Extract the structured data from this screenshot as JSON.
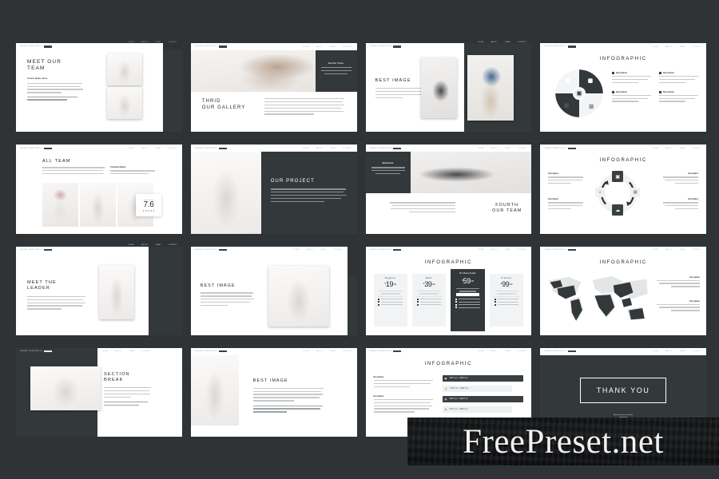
{
  "background_color": "#2f3336",
  "watermark": {
    "text": "FreePreset.net"
  },
  "slide_chrome": {
    "logo_text": "MINIMAL PRESENTATION",
    "nav": [
      "HOME",
      "ABOUT",
      "TEAM",
      "CONTACT"
    ]
  },
  "slides": [
    {
      "id": "meet-our-team",
      "title": "MEET OUR\nTEAM",
      "title_line1": "MEET OUR",
      "title_line2": "TEAM",
      "subhead": "Create Name Here",
      "body": "Lorem ipsum dolor sit amet consectetur adipiscing elit sed do eiusmod tempor incididunt ut labore et dolore magna aliqua ut enim ad minim veniam quis nostrud exercitation.",
      "body2": "Nisi ut aliquip ex ea commodo consequat duis aute irure dolor."
    },
    {
      "id": "thrid-our-gallery",
      "title_line1": "THRID",
      "title_line2": "OUR GALLERY",
      "panel_head": "Section Three",
      "panel_body": "Lorem ipsum dolor sit amet consectetur adipiscing elit sed do eiusmod tempor incididunt.",
      "body": "Excepteur sint occaecat cupidatat non proident sunt in culpa qui officia deserunt mollit anim id est laborum sed ut perspiciatis unde omnis iste natus error sit voluptatem accusantium doloremque laudantium totam rem aperiam."
    },
    {
      "id": "best-image-1",
      "title": "BEST IMAGE",
      "body": "Lorem ipsum dolor sit amet consectetur adipiscing elit sed do eiusmod tempor incididunt ut labore et dolore magna aliqua."
    },
    {
      "id": "infographic-circle",
      "title": "INFOGRAPHIC",
      "items": [
        {
          "icon": "briefcase-icon",
          "label": "Description",
          "body": "Lorem ipsum dolor sit amet consectetur adipiscing elit sed do eiusmod."
        },
        {
          "icon": "monitor-icon",
          "label": "Description",
          "body": "Lorem ipsum dolor sit amet consectetur adipiscing elit sed do eiusmod."
        },
        {
          "icon": "cloud-icon",
          "label": "Description",
          "body": "Lorem ipsum dolor sit amet consectetur adipiscing elit sed do eiusmod."
        },
        {
          "icon": "chart-icon",
          "label": "Description",
          "body": "Lorem ipsum dolor sit amet consectetur adipiscing elit sed do eiusmod."
        }
      ]
    },
    {
      "id": "all-team",
      "title": "ALL TEAM",
      "body": "Lorem ipsum dolor sit amet consectetur adipiscing elit sed do eiusmod tempor incididunt ut labore et dolore magna aliqua ut enim ad minim veniam quis nostrud.",
      "side_head": "Total Description",
      "side_body": "Lorem ipsum dolor sit amet consectetur adipiscing.",
      "rating_label": "user rating",
      "rating_value": "7.6",
      "rating_stars": 5
    },
    {
      "id": "our-project",
      "title": "OUR PROJECT",
      "body": "Lorem ipsum dolor sit amet consectetur adipiscing elit sed do eiusmod tempor incididunt ut labore et dolore magna aliqua ut enim ad minim veniam quis nostrud exercitation ullamco laboris nisi ut aliquip."
    },
    {
      "id": "fourth-our-team",
      "title_line1": "FOURTH",
      "title_line2": "OUR TEAM",
      "panel_head": "Section Four",
      "panel_body": "Lorem ipsum dolor sit amet consectetur adipiscing elit sed do eiusmod tempor incididunt ut labore.",
      "body": "Excepteur sint occaecat cupidatat non proident sunt in culpa qui officia deserunt mollit anim id est laborum sed ut perspiciatis unde omnis."
    },
    {
      "id": "infographic-cycle",
      "title": "INFOGRAPHIC",
      "items": [
        {
          "label": "Description",
          "body": "Lorem ipsum dolor sit amet consectetur adipiscing elit."
        },
        {
          "label": "Description",
          "body": "Lorem ipsum dolor sit amet consectetur adipiscing elit."
        },
        {
          "label": "Description",
          "body": "Lorem ipsum dolor sit amet consectetur adipiscing elit."
        },
        {
          "label": "Description",
          "body": "Lorem ipsum dolor sit amet consectetur adipiscing elit."
        }
      ],
      "icons": [
        "briefcase-icon",
        "monitor-icon",
        "cloud-icon",
        "search-icon"
      ]
    },
    {
      "id": "meet-the-leader",
      "title_line1": "MEET THE",
      "title_line2": "LEADER",
      "body": "Lorem ipsum dolor sit amet consectetur adipiscing elit sed do eiusmod tempor incididunt ut labore et dolore magna aliqua ut enim ad minim veniam quis nostrud exercitation ullamco laboris."
    },
    {
      "id": "best-image-2",
      "title": "BEST IMAGE",
      "body": "Lorem ipsum dolor sit amet consectetur adipiscing elit sed do eiusmod tempor incididunt ut labore et dolore magna aliqua ut enim ad minim veniam."
    },
    {
      "id": "infographic-pricing",
      "title": "INFOGRAPHIC",
      "plans": [
        {
          "name": "Begginer",
          "currency": "$",
          "amount": "19",
          "cents": ".99",
          "featured": false,
          "features": 3
        },
        {
          "name": "Basic",
          "currency": "$",
          "amount": "39",
          "cents": ".99",
          "featured": false,
          "features": 3
        },
        {
          "name": "Professional",
          "currency": "$",
          "amount": "59",
          "cents": ".99",
          "featured": true,
          "features": 4
        },
        {
          "name": "Premium",
          "currency": "$",
          "amount": "99",
          "cents": ".99",
          "featured": false,
          "features": 3
        }
      ]
    },
    {
      "id": "infographic-map",
      "title": "INFOGRAPHIC",
      "items": [
        {
          "label": "Description",
          "body": "Lorem ipsum dolor sit amet consectetur adipiscing elit sed do eiusmod tempor."
        },
        {
          "label": "Description",
          "body": "Lorem ipsum dolor sit amet consectetur adipiscing elit sed do eiusmod tempor."
        }
      ]
    },
    {
      "id": "section-break",
      "title_line1": "SECTION",
      "title_line2": "BREAK",
      "body": "Lorem ipsum dolor sit amet consectetur adipiscing elit sed do eiusmod tempor incididunt ut labore et dolore magna aliqua.",
      "body2": "Lorem ipsum dolor sit amet consectetur adipiscing elit."
    },
    {
      "id": "best-image-3",
      "title": "BEST IMAGE",
      "body": "Lorem ipsum dolor sit amet consectetur adipiscing elit sed do eiusmod tempor incididunt ut labore et dolore magna aliqua ut enim ad minim veniam quis nostrud exercitation.",
      "body2": "Lorem ipsum dolor sit amet consectetur adipiscing elit sed do eiusmod tempor."
    },
    {
      "id": "infographic-bars",
      "title": "INFOGRAPHIC",
      "left_blocks": [
        {
          "label": "Description",
          "body": "Lorem ipsum dolor sit amet consectetur adipiscing elit sed do eiusmod tempor incididunt."
        },
        {
          "label": "Description",
          "body": "Lorem ipsum dolor sit amet consectetur adipiscing elit sed do eiusmod tempor incididunt ut labore et dolore magna."
        }
      ],
      "bars": [
        {
          "icon": "briefcase-icon",
          "label": "TEXT px • PERT px",
          "style": "dark"
        },
        {
          "icon": "thumbs-up-icon",
          "label": "TEXT px • PERT px",
          "style": "light"
        },
        {
          "icon": "printer-icon",
          "label": "TEXT px • PERT px",
          "style": "dark"
        },
        {
          "icon": "lab-icon",
          "label": "TEXT px • PERT px",
          "style": "light"
        }
      ]
    },
    {
      "id": "thank-you",
      "title": "THANK YOU",
      "subtitle": "Minimal presentation\ntemplate"
    }
  ]
}
